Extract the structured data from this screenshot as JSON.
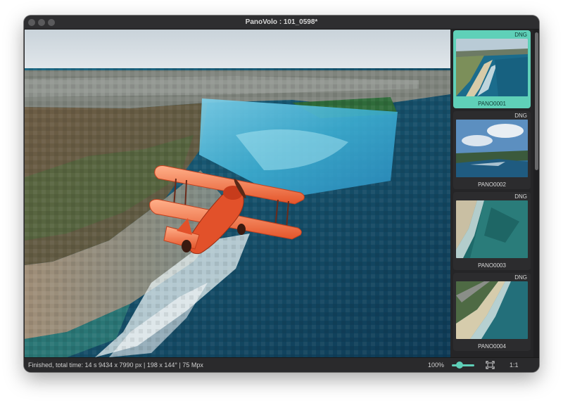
{
  "window": {
    "title": "PanoVolo : 101_0598*"
  },
  "sidebar": {
    "items": [
      {
        "label": "PANO0001",
        "tag": "DNG",
        "selected": true
      },
      {
        "label": "PANO0002",
        "tag": "DNG",
        "selected": false
      },
      {
        "label": "PANO0003",
        "tag": "DNG",
        "selected": false
      },
      {
        "label": "PANO0004",
        "tag": "DNG",
        "selected": false
      }
    ]
  },
  "status": {
    "message": "Finished, total time: 14 s",
    "info": "9434 x 7990 px | 198 x 144° | 75 Mpx",
    "zoom": "100%",
    "zoom_fraction": 0.35,
    "one_to_one": "1:1"
  },
  "colors": {
    "accent": "#5fd0b8",
    "window_bg": "#252527",
    "plane": "#f0703a"
  },
  "icons": [
    "fit-to-window-icon",
    "zoom-slider"
  ]
}
